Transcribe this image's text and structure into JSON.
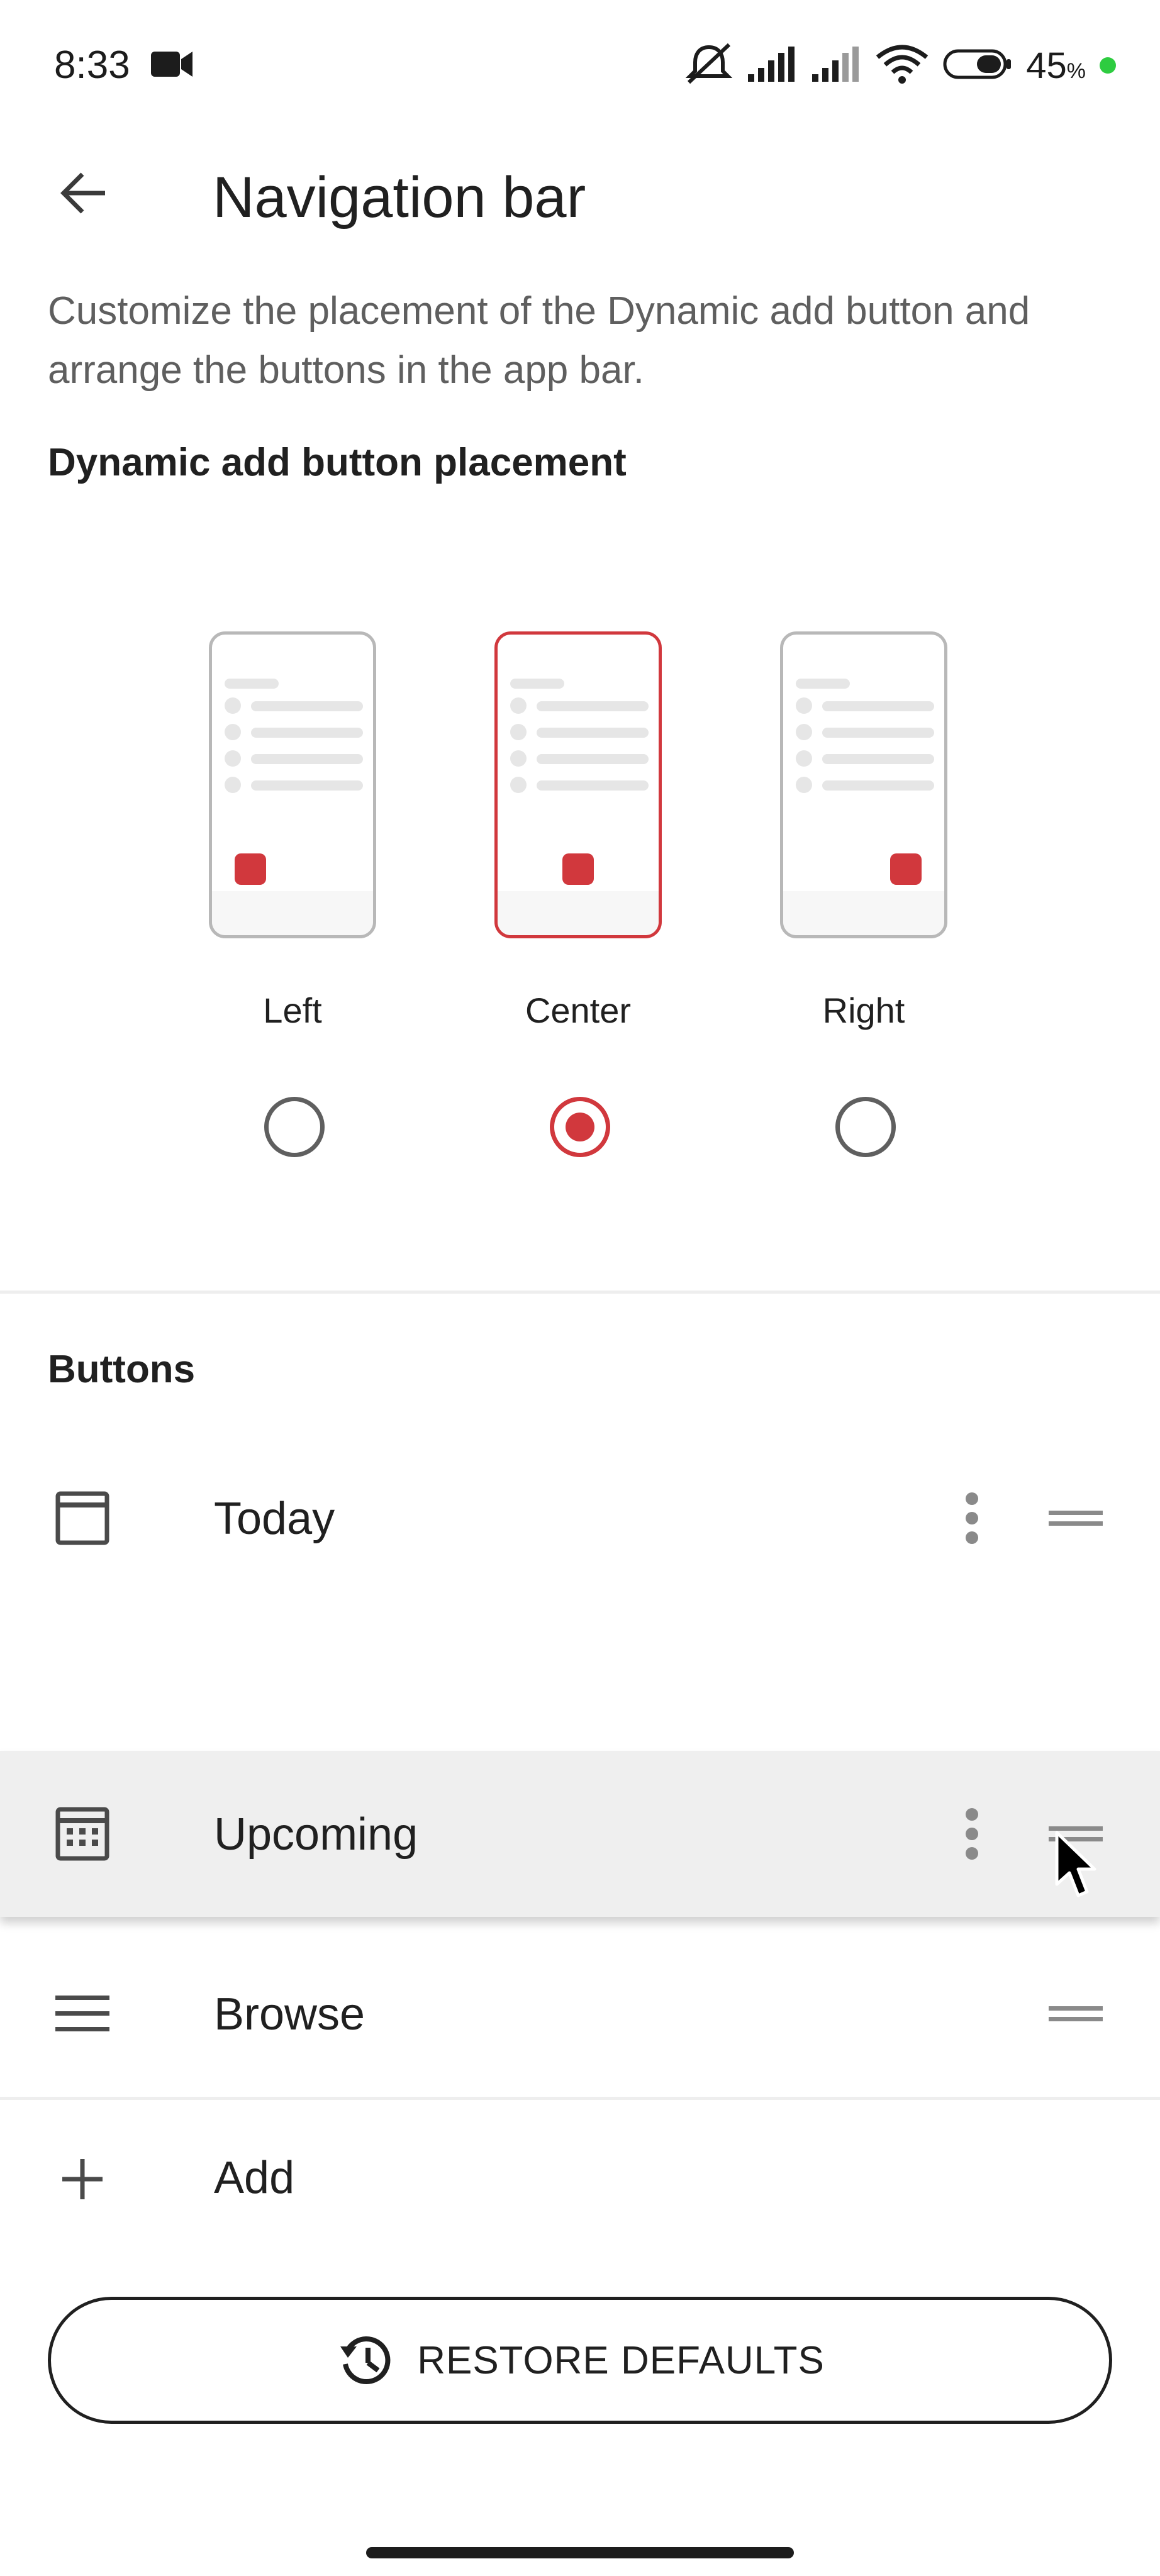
{
  "status_bar": {
    "time": "8:33",
    "battery_percent": "45",
    "battery_unit": "%",
    "icons": [
      "video-camera-icon",
      "mute-icon",
      "signal-icon",
      "signal-icon",
      "wifi-icon",
      "battery-icon"
    ]
  },
  "app_bar": {
    "title": "Navigation bar",
    "back_icon": "arrow-left-icon"
  },
  "description": "Customize the placement of the Dynamic add button and arrange the buttons in the app bar.",
  "placement": {
    "heading": "Dynamic add button placement",
    "options": [
      {
        "label": "Left",
        "selected": false
      },
      {
        "label": "Center",
        "selected": true
      },
      {
        "label": "Right",
        "selected": false
      }
    ]
  },
  "buttons": {
    "heading": "Buttons",
    "items": [
      {
        "label": "Today",
        "icon": "calendar-today-icon"
      },
      {
        "label": "Upcoming",
        "icon": "calendar-grid-icon",
        "dragging": true
      },
      {
        "label": "Browse",
        "icon": "menu-icon"
      },
      {
        "label": "Add",
        "icon": "plus-icon"
      }
    ]
  },
  "restore": {
    "label": "RESTORE DEFAULTS",
    "icon": "history-icon"
  },
  "colors": {
    "accent": "#d1383d",
    "text": "#202020",
    "secondary_text": "#5f5f5f"
  }
}
